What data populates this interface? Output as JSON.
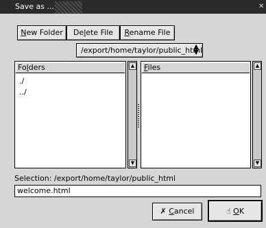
{
  "window": {
    "title": "Save as ..."
  },
  "toolbar": {
    "new_folder": {
      "mnemonic": "N",
      "rest": "ew Folder"
    },
    "delete_file": {
      "pre": "De",
      "mnemonic": "l",
      "rest": "ete File"
    },
    "rename_file": {
      "mnemonic": "R",
      "rest": "ename File"
    }
  },
  "path_select": {
    "value": "/export/home/taylor/public_html"
  },
  "folders": {
    "header_pre": "Fo",
    "header_mnemonic": "l",
    "header_rest": "ders",
    "items": [
      "./",
      "../"
    ]
  },
  "files": {
    "header_mnemonic": "F",
    "header_rest": "iles",
    "items": []
  },
  "selection": {
    "label": "Selection: /export/home/taylor/public_html",
    "filename": "welcome.html"
  },
  "buttons": {
    "cancel": {
      "mnemonic": "C",
      "rest": "ancel"
    },
    "ok": {
      "mnemonic": "O",
      "rest": "K"
    }
  }
}
